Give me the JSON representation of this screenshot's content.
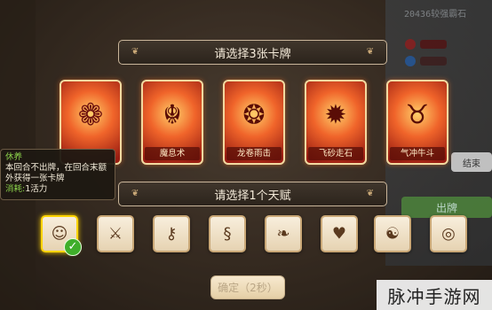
{
  "header": {
    "select_cards": "请选择3张卡牌",
    "select_talent": "请选择1个天赋"
  },
  "hud": {
    "player_id": "20436较强霸石"
  },
  "cards": [
    {
      "name": "",
      "icon": "flame-mascot-icon"
    },
    {
      "name": "魔息术",
      "icon": "demon-breath-icon"
    },
    {
      "name": "龙卷雨击",
      "icon": "tornado-icon"
    },
    {
      "name": "飞砂走石",
      "icon": "flying-sand-icon"
    },
    {
      "name": "气冲牛斗",
      "icon": "bull-charge-icon"
    }
  ],
  "talents": [
    {
      "icon": "rest-icon",
      "selected": true
    },
    {
      "icon": "claw-icon",
      "selected": false
    },
    {
      "icon": "key-icon",
      "selected": false
    },
    {
      "icon": "scroll-icon",
      "selected": false
    },
    {
      "icon": "leaf-icon",
      "selected": false
    },
    {
      "icon": "broken-heart-icon",
      "selected": false
    },
    {
      "icon": "dragon-icon",
      "selected": false
    },
    {
      "icon": "target-icon",
      "selected": false
    }
  ],
  "tooltip": {
    "title": "休养",
    "body": "本回合不出牌，在回合末额外获得一张卡牌",
    "cost_label": "消耗:",
    "cost_value": "1活力"
  },
  "side": {
    "end_label": "结束",
    "play_label": "出牌"
  },
  "confirm": {
    "label": "确定（2秒）"
  },
  "watermark": {
    "text": "脉冲手游网"
  },
  "colors": {
    "accent": "#ffd400",
    "card_glow": "#f0642a",
    "check": "#3fae2a"
  }
}
